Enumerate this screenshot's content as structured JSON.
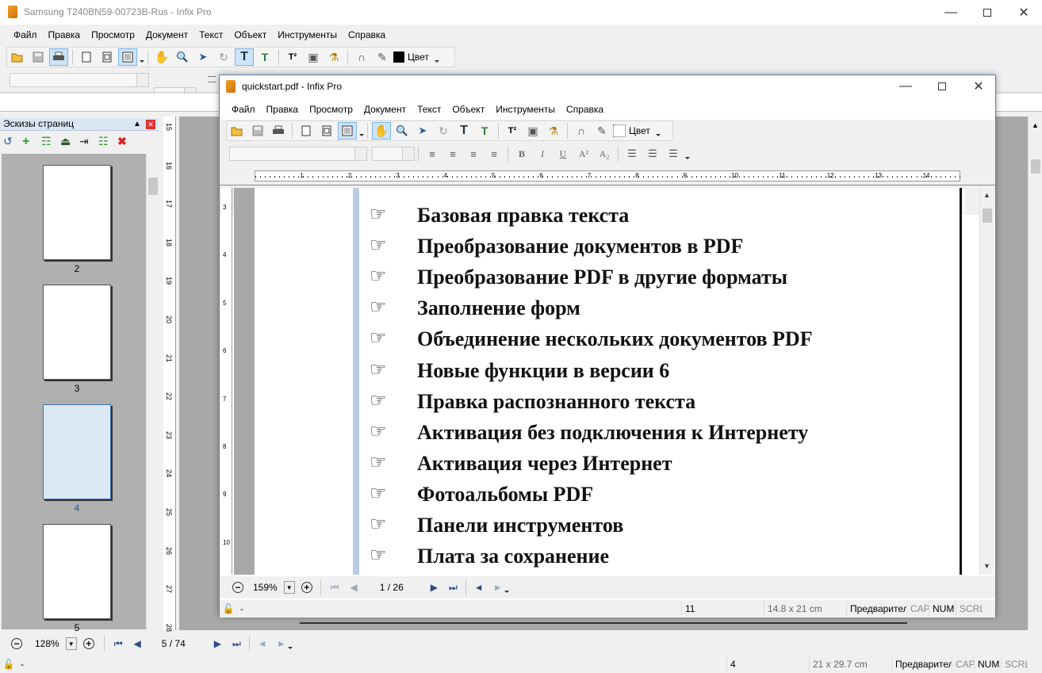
{
  "outer": {
    "title": "Samsung T240BN59-00723B-Rus - Infix Pro",
    "menu": [
      "Файл",
      "Правка",
      "Просмотр",
      "Документ",
      "Текст",
      "Объект",
      "Инструменты",
      "Справка"
    ],
    "color_label": "Цвет",
    "panel_title": "Эскизы страниц",
    "thumb_numbers": [
      "2",
      "3",
      "4",
      "5"
    ],
    "ruler_numbers": [
      "15",
      "16",
      "17",
      "18",
      "19",
      "20",
      "21",
      "22",
      "23",
      "24",
      "25",
      "26",
      "27",
      "28"
    ],
    "zoom": "128%",
    "page_nav": "5 / 74",
    "status": {
      "lock": "-",
      "page": "4",
      "size": "21 x 29.7 cm",
      "mode": "Предварител",
      "cap": "CAP",
      "num": "NUM",
      "scrl": "SCRL"
    }
  },
  "inner": {
    "title": "quickstart.pdf - Infix Pro",
    "menu": [
      "Файл",
      "Правка",
      "Просмотр",
      "Документ",
      "Текст",
      "Объект",
      "Инструменты",
      "Справка"
    ],
    "color_label": "Цвет",
    "ruler_h": [
      "1",
      "2",
      "3",
      "4",
      "5",
      "6",
      "7",
      "8",
      "9",
      "10",
      "11",
      "12",
      "13",
      "14"
    ],
    "ruler_v": [
      "3",
      "4",
      "5",
      "6",
      "7",
      "8",
      "9",
      "10"
    ],
    "items": [
      "Базовая правка текста",
      "Преобразование документов в PDF",
      "Преобразование PDF в другие форматы",
      "Заполнение форм",
      "Объединение нескольких документов PDF",
      "Новые функции в версии 6",
      "Правка распознанного текста",
      "Активация без подключения к Интернету",
      "Активация через Интернет",
      "Фотоальбомы PDF",
      "Панели инструментов",
      "Плата за сохранение"
    ],
    "zoom": "159%",
    "page_nav": "1 / 26",
    "status": {
      "lock": "-",
      "page": "11",
      "size": "14.8 x 21 cm",
      "mode": "Предварител",
      "cap": "CAP",
      "num": "NUM",
      "scrl": "SCRL"
    }
  }
}
